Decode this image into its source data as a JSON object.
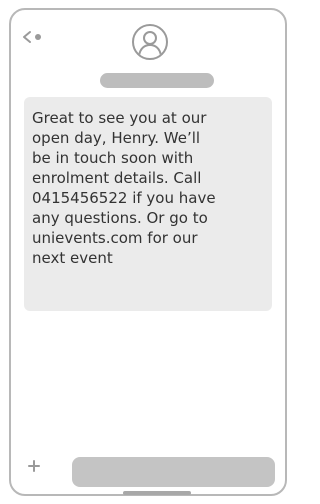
{
  "header": {
    "back_icon": "chevron-left-dot-icon",
    "avatar_icon": "person-icon"
  },
  "message": {
    "text": "Great to see you at our\nopen day, Henry. We’ll\nbe in touch soon with\nenrolment details. Call\n0415456522 if you have\nany questions. Or go to\nunievents.com for our\nnext event"
  },
  "composer": {
    "add_icon": "plus-icon",
    "input_value": ""
  },
  "colors": {
    "frame": "#b8b8b8",
    "bubble": "#ebebeb",
    "placeholder_bar": "#bdbdbd",
    "input": "#c4c4c4",
    "icon": "#9a9a9a",
    "text": "#333333"
  }
}
